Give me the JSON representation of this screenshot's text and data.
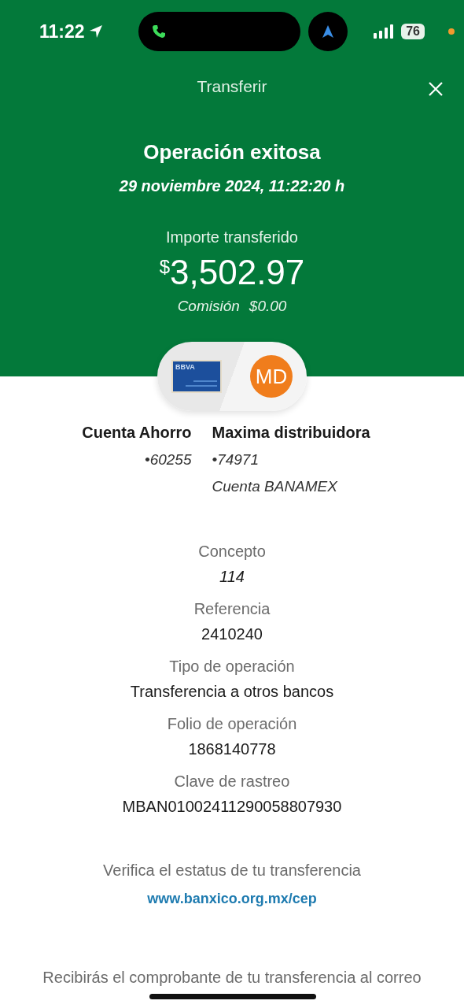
{
  "status_bar": {
    "time": "11:22",
    "battery": "76"
  },
  "header": {
    "title": "Transferir"
  },
  "result": {
    "title": "Operación exitosa",
    "date": "29 noviembre 2024, 11:22:20 h",
    "amount_label": "Importe transferido",
    "currency": "$",
    "amount": "3,502.97",
    "fee_label": "Comisión",
    "fee": "$0.00"
  },
  "accounts": {
    "card_logo": "BBVA",
    "avatar": "MD",
    "origin": {
      "name": "Cuenta Ahorro",
      "number": "•60255"
    },
    "destination": {
      "name": "Maxima distribuidora",
      "number": "•74971",
      "bank": "Cuenta BANAMEX"
    }
  },
  "details": [
    {
      "label": "Concepto",
      "value": "114",
      "italic": true
    },
    {
      "label": "Referencia",
      "value": "2410240",
      "italic": false
    },
    {
      "label": "Tipo de operación",
      "value": "Transferencia a otros bancos",
      "italic": false
    },
    {
      "label": "Folio de operación",
      "value": "1868140778",
      "italic": false
    },
    {
      "label": "Clave de rastreo",
      "value": "MBAN01002411290058807930",
      "italic": false
    }
  ],
  "verify": {
    "text": "Verifica el estatus de tu transferencia",
    "link": "www.banxico.org.mx/cep"
  },
  "footer_note": "Recibirás el comprobante de tu transferencia al correo"
}
